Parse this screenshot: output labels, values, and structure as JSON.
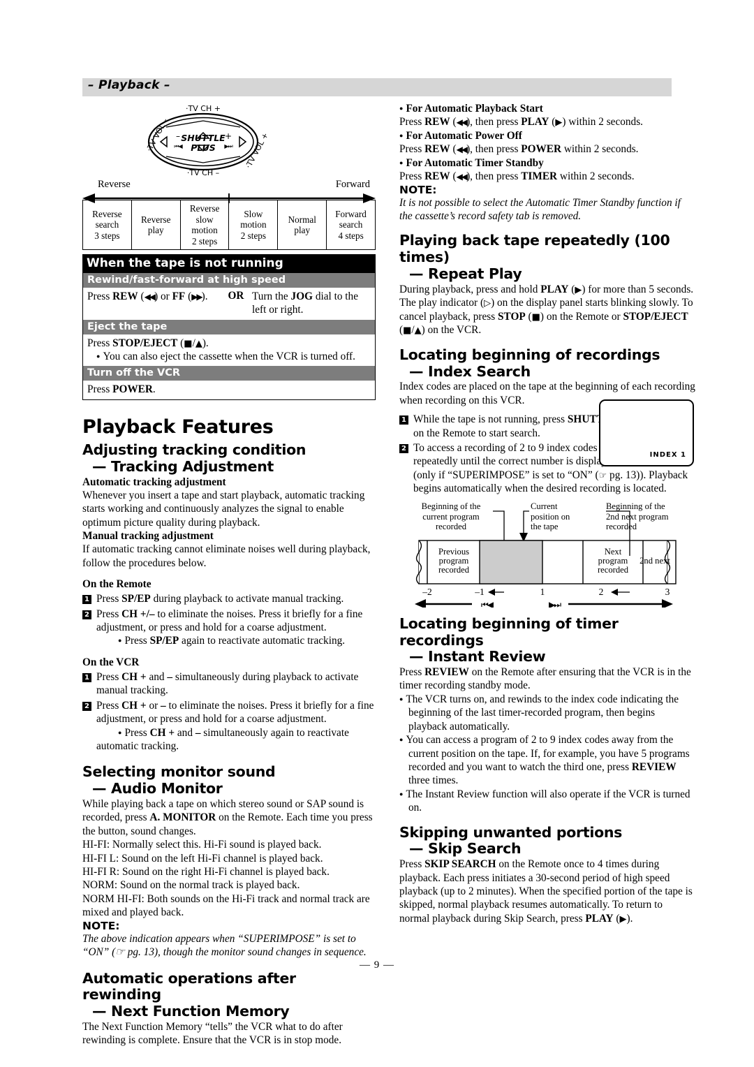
{
  "section": {
    "label": "– Playback –"
  },
  "shuttle_diagram": {
    "top_label": "·TV CH +",
    "bottom_label": "·TV CH –",
    "left_label": "·TV VOL –",
    "right_label": "·TV VOL +",
    "center_line1": "SHUTTLE",
    "center_line2": "PLUS",
    "minus": "–",
    "plus": "+",
    "reverse_label": "Reverse",
    "forward_label": "Forward"
  },
  "speed_table": {
    "cells": [
      "Reverse\nsearch\n3 steps",
      "Reverse\nplay",
      "Reverse\nslow\nmotion\n2 steps",
      "Slow\nmotion\n2 steps",
      "Normal\nplay",
      "Forward\nsearch\n4 steps"
    ]
  },
  "not_running_table": {
    "title": "When the tape is not running",
    "rows": [
      {
        "header": "Rewind/fast-forward at high speed",
        "left": "Press REW (◀◀) or FF (▶▶).",
        "or": "OR",
        "right": "Turn the JOG dial to the left or right."
      },
      {
        "header": "Eject the tape",
        "line1": "Press STOP/EJECT (■ / ▲).",
        "bullet": "You can also eject the cassette when the VCR is turned off."
      },
      {
        "header": "Turn off the VCR",
        "line1": "Press POWER."
      }
    ]
  },
  "playback_features": {
    "title": "Playback Features",
    "tracking": {
      "heading": "Adjusting tracking condition",
      "subheading": "— Tracking Adjustment",
      "auto_head": "Automatic tracking adjustment",
      "auto_text": "Whenever you insert a tape and start playback, automatic tracking starts working and continuously analyzes the signal to enable optimum picture quality during playback.",
      "manual_head": "Manual tracking adjustment",
      "manual_text": "If automatic tracking cannot eliminate noises well during playback, follow the procedures below.",
      "remote_head": "On the Remote",
      "remote_step1": "Press SP/EP during playback to activate manual tracking.",
      "remote_step2": "Press CH +/– to eliminate the noises. Press it briefly for a fine adjustment, or press and hold for a coarse adjustment.",
      "remote_step2_bullet": "Press SP/EP again to reactivate automatic tracking.",
      "vcr_head": "On the VCR",
      "vcr_step1": "Press CH + and – simultaneously during playback to activate manual tracking.",
      "vcr_step2": "Press CH + or – to eliminate the noises. Press it briefly for a fine adjustment, or press and hold for a coarse adjustment.",
      "vcr_step2_bullet": "Press CH + and – simultaneously again to reactivate automatic tracking."
    },
    "audio_monitor": {
      "heading": "Selecting monitor sound",
      "subheading": "— Audio Monitor",
      "intro": "While playing back a tape on which stereo sound or SAP sound is recorded, press A. MONITOR on the Remote. Each time you press the button, sound changes.",
      "modes": [
        "HI-FI: Normally select this. Hi-Fi sound is played back.",
        "HI-FI L: Sound on the left Hi-Fi channel is played back.",
        "HI-FI R: Sound on the right Hi-Fi channel is played back.",
        "NORM: Sound on the normal track is played back.",
        "NORM HI-FI: Both sounds on the Hi-Fi track and normal track are mixed and played back."
      ],
      "note_label": "NOTE:",
      "note_text": "The above indication appears when “SUPERIMPOSE” is set to “ON” (☞ pg. 13), though the monitor sound changes in sequence."
    },
    "next_function": {
      "heading": "Automatic operations after rewinding",
      "subheading": "— Next Function Memory",
      "text": "The Next Function Memory “tells” the VCR what to do after rewinding is complete. Ensure that the VCR is in stop mode."
    }
  },
  "right_column": {
    "auto_ops": [
      {
        "head": "For Automatic Playback Start",
        "text": "Press REW (◀◀), then press PLAY (▶) within 2 seconds."
      },
      {
        "head": "For Automatic Power Off",
        "text": "Press REW (◀◀), then press POWER within 2 seconds."
      },
      {
        "head": "For Automatic Timer Standby",
        "text": "Press REW (◀◀), then press TIMER within 2 seconds."
      }
    ],
    "note_label": "NOTE:",
    "note_text": "It is not possible to select the Automatic Timer Standby function if the cassette’s record safety tab is removed.",
    "repeat_play": {
      "heading": "Playing back tape repeatedly (100 times)",
      "subheading": "— Repeat Play",
      "text": "During playback, press and hold PLAY (▶) for more than 5 seconds. The play indicator (▷) on the display panel starts blinking slowly. To cancel playback, press STOP (■) on the Remote or STOP/EJECT (■ / ▲) on the VCR."
    },
    "index_search": {
      "heading": "Locating beginning of recordings",
      "subheading": "— Index Search",
      "intro": "Index codes are placed on the tape at the beginning of each recording when recording on this VCR.",
      "step1": "While the tape is not running, press SHUTTLE PLUS |◀◀ or ▶▶| on the Remote to start search.",
      "step2": "To access a recording of 2 to 9 index codes away, press |◀◀ or ▶▶| repeatedly until the correct number is displayed on the screen (only if “SUPERIMPOSE” is set to “ON” (☞ pg. 13)). Playback begins automatically when the desired recording is located.",
      "screen_text": "INDEX  1"
    },
    "tape_diagram": {
      "caption_left": "Beginning of the\ncurrent program\nrecorded",
      "caption_mid": "Current\nposition on\nthe tape",
      "caption_right": "Beginning of the\n2nd next program\nrecorded",
      "seg_prev": "Previous\nprogram\nrecorded",
      "seg_next": "Next\nprogram\nrecorded",
      "seg_2nd": "2nd next",
      "ticks": [
        "–2",
        "–1",
        "1",
        "2",
        "3"
      ],
      "rew_glyph": "|◀◀",
      "ff_glyph": "▶▶|"
    },
    "instant_review": {
      "heading": "Locating beginning of timer recordings",
      "subheading": "— Instant Review",
      "intro": "Press REVIEW on the Remote after ensuring that the VCR is in the timer recording standby mode.",
      "bullets": [
        "The VCR turns on, and rewinds to the index code indicating the beginning of the last timer-recorded program, then begins playback automatically.",
        "You can access a program of 2 to 9 index codes away from the current position on the tape. If, for example, you have 5 programs recorded and you want to watch the third one, press REVIEW three times.",
        "The Instant Review function will also operate if the VCR is turned on."
      ]
    },
    "skip_search": {
      "heading": "Skipping unwanted portions",
      "subheading": "— Skip Search",
      "text": "Press SKIP SEARCH on the Remote once to 4 times during playback. Each press initiates a 30-second period of high speed playback (up to 2 minutes). When the specified portion of the tape is skipped, normal playback resumes automatically. To return to normal playback during Skip Search, press PLAY (▶)."
    }
  },
  "footer": {
    "page_number": "— 9 —"
  }
}
